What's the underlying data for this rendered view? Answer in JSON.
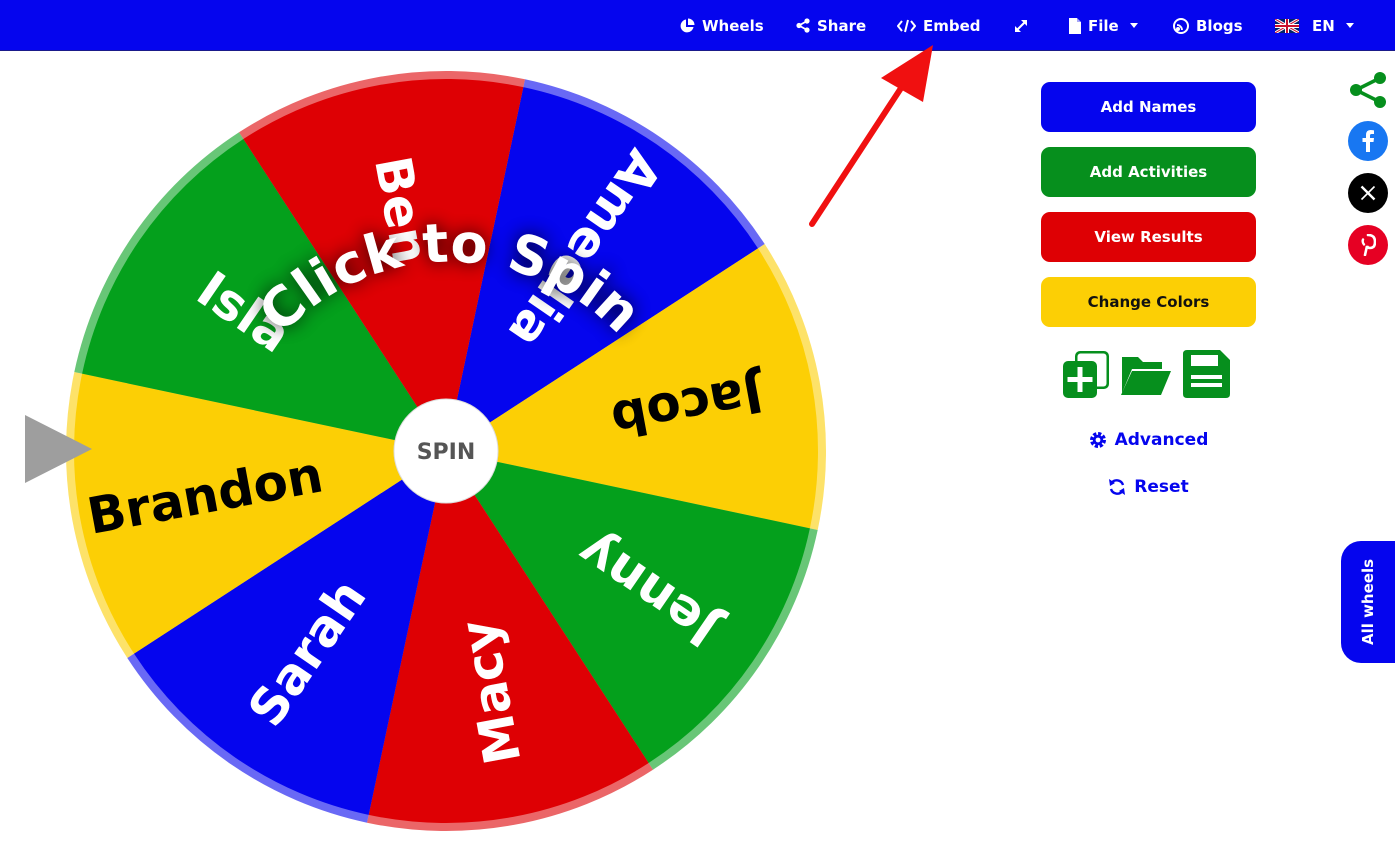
{
  "nav": {
    "wheels": "Wheels",
    "share": "Share",
    "embed": "Embed",
    "file": "File",
    "blogs": "Blogs",
    "language": "EN"
  },
  "wheel": {
    "center_label": "SPIN",
    "overlay_text": "Click to Spin",
    "segments": [
      {
        "name": "Ameelia",
        "color": "#0505ee",
        "text_color": "#ffffff"
      },
      {
        "name": "Jacob",
        "color": "#fccf05",
        "text_color": "#000000"
      },
      {
        "name": "Jenny",
        "color": "#04a01c",
        "text_color": "#ffffff"
      },
      {
        "name": "Macy",
        "color": "#de0004",
        "text_color": "#ffffff"
      },
      {
        "name": "Sarah",
        "color": "#0505ee",
        "text_color": "#ffffff"
      },
      {
        "name": "Brandon",
        "color": "#fccf05",
        "text_color": "#000000"
      },
      {
        "name": "Isla",
        "color": "#04a01c",
        "text_color": "#ffffff"
      },
      {
        "name": "Ben",
        "color": "#de0004",
        "text_color": "#ffffff"
      }
    ]
  },
  "panel": {
    "add_names": "Add Names",
    "add_activities": "Add Activities",
    "view_results": "View Results",
    "change_colors": "Change Colors",
    "advanced": "Advanced",
    "reset": "Reset"
  },
  "side_tab": "All wheels",
  "colors": {
    "nav_blue": "#0505ee",
    "green": "#04a01c",
    "red": "#de0004",
    "yellow": "#fccf05",
    "facebook": "#1877f2",
    "pinterest": "#e60023"
  },
  "icons": [
    "chart-pie-icon",
    "share-nodes-icon",
    "code-icon",
    "expand-icon",
    "file-icon",
    "blog-icon",
    "uk-flag-icon",
    "gear-icon",
    "refresh-icon",
    "copy-plus-icon",
    "folder-open-icon",
    "floppy-disk-icon",
    "facebook-icon",
    "x-logo-icon",
    "pinterest-icon",
    "share-alt-icon"
  ]
}
